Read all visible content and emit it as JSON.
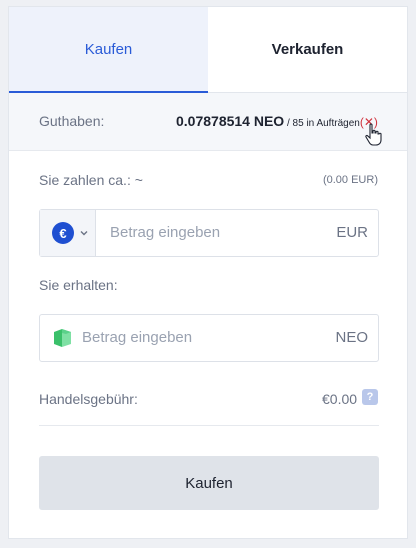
{
  "tabs": {
    "buy": "Kaufen",
    "sell": "Verkaufen"
  },
  "balance": {
    "label": "Guthaben:",
    "amount": "0.07878514 NEO",
    "orders": " / 85 in Aufträgen",
    "cancel": "(✕)"
  },
  "pay": {
    "label": "Sie zahlen ca.: ~",
    "converted": "(0.00 EUR)",
    "placeholder": "Betrag eingeben",
    "currency": "EUR",
    "currency_symbol": "€"
  },
  "receive": {
    "label": "Sie erhalten:",
    "placeholder": "Betrag eingeben",
    "currency": "NEO"
  },
  "fee": {
    "label": "Handelsgebühr:",
    "value": "€0.00",
    "help": "?"
  },
  "submit": {
    "label": "Kaufen"
  },
  "colors": {
    "accent": "#2a5bd7",
    "neo_green": "#4ccf7a",
    "cancel_red": "#d0323c"
  },
  "icons": [
    "euro-icon",
    "chevron-down-icon",
    "neo-icon",
    "help-icon",
    "hand-cursor-icon"
  ]
}
